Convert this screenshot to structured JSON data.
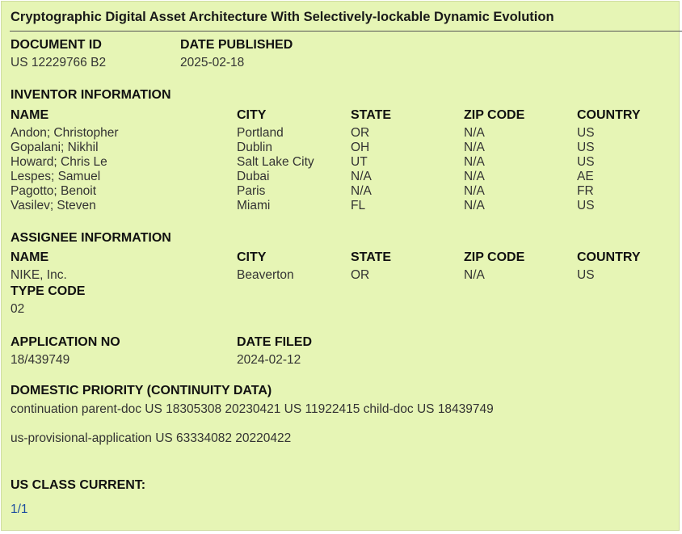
{
  "title": "Cryptographic Digital Asset Architecture With Selectively-lockable Dynamic Evolution",
  "document": {
    "id_label": "DOCUMENT ID",
    "id_value": "US 12229766 B2",
    "date_label": "DATE PUBLISHED",
    "date_value": "2025-02-18"
  },
  "inventors": {
    "section_label": "INVENTOR INFORMATION",
    "columns": [
      "NAME",
      "CITY",
      "STATE",
      "ZIP CODE",
      "COUNTRY"
    ],
    "rows": [
      [
        "Andon; Christopher",
        "Portland",
        "OR",
        "N/A",
        "US"
      ],
      [
        "Gopalani; Nikhil",
        "Dublin",
        "OH",
        "N/A",
        "US"
      ],
      [
        "Howard; Chris Le",
        "Salt Lake City",
        "UT",
        "N/A",
        "US"
      ],
      [
        "Lespes; Samuel",
        "Dubai",
        "N/A",
        "N/A",
        "AE"
      ],
      [
        "Pagotto; Benoit",
        "Paris",
        "N/A",
        "N/A",
        "FR"
      ],
      [
        "Vasilev; Steven",
        "Miami",
        "FL",
        "N/A",
        "US"
      ]
    ]
  },
  "assignee": {
    "section_label": "ASSIGNEE INFORMATION",
    "columns": [
      "NAME",
      "CITY",
      "STATE",
      "ZIP CODE",
      "COUNTRY"
    ],
    "rows": [
      [
        "NIKE, Inc.",
        "Beaverton",
        "OR",
        "N/A",
        "US"
      ]
    ],
    "type_code_label": "TYPE CODE",
    "type_code_value": "02"
  },
  "application": {
    "no_label": "APPLICATION NO",
    "no_value": "18/439749",
    "filed_label": "DATE FILED",
    "filed_value": "2024-02-12"
  },
  "priority": {
    "label": "DOMESTIC PRIORITY (CONTINUITY DATA)",
    "lines": [
      "continuation parent-doc US 18305308 20230421 US 11922415 child-doc US 18439749",
      "us-provisional-application US 63334082 20220422"
    ]
  },
  "us_class": {
    "label": "US CLASS CURRENT:",
    "pager": "1/1"
  }
}
